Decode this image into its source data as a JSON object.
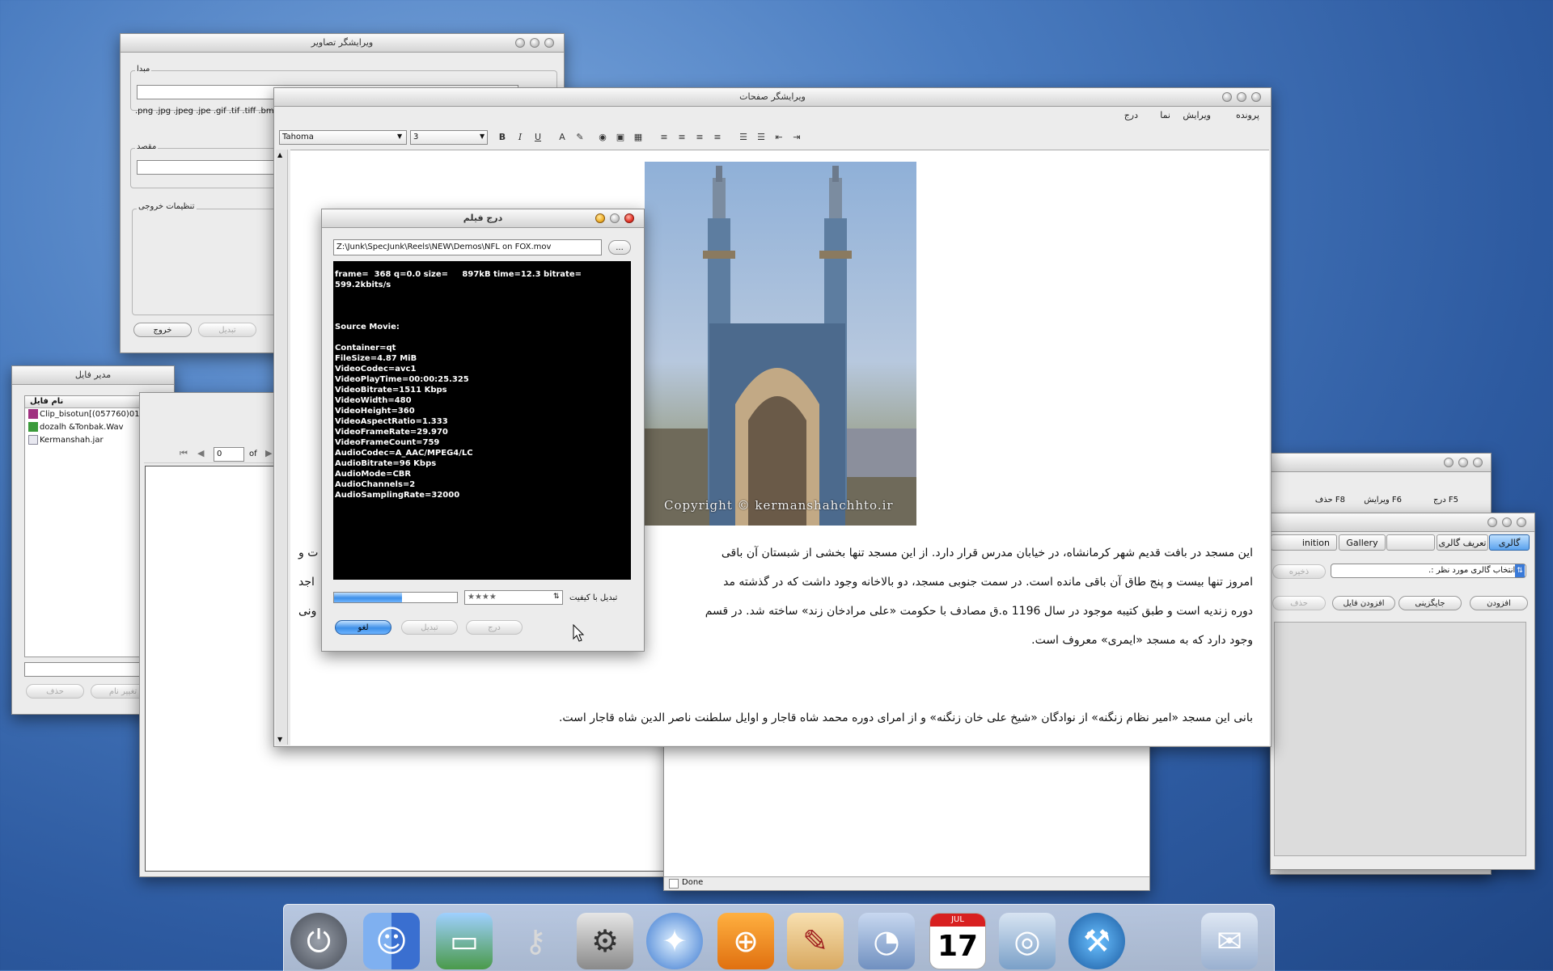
{
  "image_editor": {
    "title": "ویرایشگر تصاویر",
    "source_label": "مبدا",
    "extensions": ".png .jpg .jpeg .jpe .gif .tif .tiff .bm",
    "dest_label": "مقصد",
    "output_settings_label": "تنظیمات خروجی",
    "exit_button": "خروج",
    "convert_button": "تبدیل"
  },
  "file_manager": {
    "title": "مدیر فایل",
    "column_header": "نام فایل",
    "files": [
      {
        "name": "Clip_bisotun[(057760)01",
        "icon": "movie-file-icon"
      },
      {
        "name": "dozalh &Tonbak.Wav",
        "icon": "audio-file-icon"
      },
      {
        "name": "Kermanshah.jar",
        "icon": "jar-file-icon"
      }
    ],
    "pager_value": "0",
    "pager_of": "of",
    "delete_button": "حذف",
    "rename_button": "تغییر نام"
  },
  "page_editor": {
    "title": "ویرایشگر صفحات",
    "menu": [
      "پرونده",
      "ویرایش",
      "نما",
      "درج"
    ],
    "font_name": "Tahoma",
    "font_size": "3",
    "image_watermark": "Copyright © kermanshahchhto.ir",
    "paragraph1_line1": "این مسجد در بافت قدیم شهر کرمانشاه، در خیابان مدرس قرار دارد. از این مسجد تنها بخشی از شبستان آن باقی",
    "paragraph1_line1_tail": "ت و",
    "paragraph1_line2": "امروز تنها بیست و پنج طاق آن باقی مانده است. در سمت جنوبی مسجد، دو بالاخانه وجود داشت که در گذشته مد",
    "paragraph1_line2_tail": "اجد",
    "paragraph1_line3": "دوره زندیه است و طبق کتیبه موجود در سال 1196 ه.ق مصادف با حکومت «علی مرادخان زند» ساخته شد. در قسم",
    "paragraph1_line3_tail": "ونی",
    "paragraph1_line4": "وجود دارد که به مسجد «ایمری» معروف است.",
    "paragraph2": "بانی این مسجد «امیر نظام زنگنه» از نوادگان «شیخ علی خان زنگنه» و از امرای دوره محمد شاه قاجار و اوایل سلطنت ناصر الدین شاه قاجار است."
  },
  "insert_movie": {
    "title": "درج فیلم",
    "path": "Z:\\Junk\\SpecJunk\\Reels\\NEW\\Demos\\NFL on FOX.mov",
    "browse_button": "...",
    "console_lines": [
      "frame=  368 q=0.0 size=     897kB time=12.3 bitrate=",
      "599.2kbits/s",
      "",
      "",
      "",
      "Source Movie:",
      "",
      "Container=qt",
      "FileSize=4.87 MiB",
      "VideoCodec=avc1",
      "VideoPlayTime=00:00:25.325",
      "VideoBitrate=1511 Kbps",
      "VideoWidth=480",
      "VideoHeight=360",
      "VideoAspectRatio=1.333",
      "VideoFrameRate=29.970",
      "VideoFrameCount=759",
      "AudioCodec=A_AAC/MPEG4/LC",
      "AudioBitrate=96 Kbps",
      "AudioMode=CBR",
      "AudioChannels=2",
      "AudioSamplingRate=32000"
    ],
    "progress": 0.55,
    "quality_value": "★★★★",
    "quality_label": "تبدیل با کیفیت",
    "cancel_button": "لغو",
    "convert_button": "تبدیل",
    "insert_button": "درج"
  },
  "gallery_back": {
    "menu": [
      "درج F5",
      "ویرایش F6",
      "حذف F8"
    ]
  },
  "gallery": {
    "tabs": [
      "گالری",
      "تعریف گالری",
      "",
      "Gallery",
      "inition"
    ],
    "select_value": ".: انتخاب گالری مورد نظر :.",
    "save_button": "ذخیره",
    "add_button": "افزودن",
    "replace_button": "جایگزینی",
    "add_file_button": "افزودن فایل",
    "delete_button": "حذف"
  },
  "browser_status": "Done",
  "dock": {
    "items": [
      "power-icon",
      "finder-icon",
      "photos-folder-icon",
      "keychain-icon",
      "system-preferences-icon",
      "safari-icon",
      "disk-utility-icon",
      "textedit-icon",
      "itunes-folder-icon",
      "ical-icon",
      "iphoto-icon",
      "network-utility-icon",
      "mail-folder-icon"
    ],
    "ical_month": "JUL",
    "ical_day": "17"
  }
}
